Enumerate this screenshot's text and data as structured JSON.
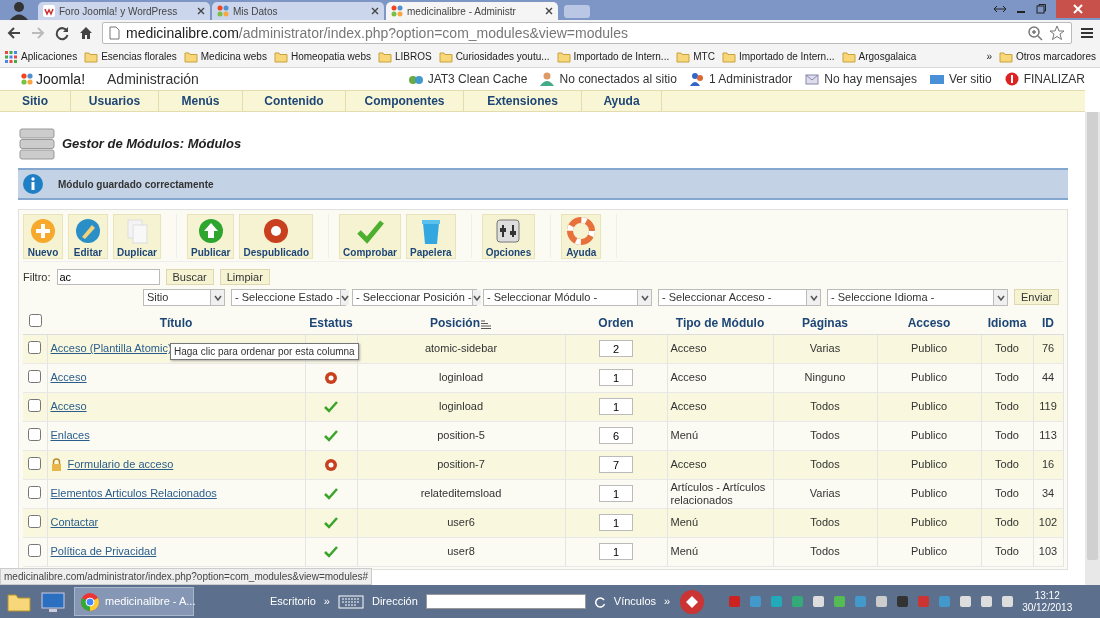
{
  "browser": {
    "tabs": [
      {
        "title": "Foro Joomla! y WordPress",
        "selected": false,
        "kind": "forum"
      },
      {
        "title": "Mis Datos",
        "selected": false,
        "kind": "joomla"
      },
      {
        "title": "medicinalibre - Administr",
        "selected": true,
        "kind": "joomla"
      }
    ],
    "url": {
      "host": "medicinalibre.com",
      "path": "/administrator/index.php?option=com_modules&view=modules"
    },
    "bookmarks": [
      {
        "label": "Aplicaciones",
        "kind": "apps"
      },
      {
        "label": "Esencias florales",
        "kind": "folder"
      },
      {
        "label": "Medicina webs",
        "kind": "folder"
      },
      {
        "label": "Homeopatia webs",
        "kind": "folder"
      },
      {
        "label": "LIBROS",
        "kind": "folder"
      },
      {
        "label": "Curiosidades youtu...",
        "kind": "folder"
      },
      {
        "label": "Importado de Intern...",
        "kind": "folder"
      },
      {
        "label": "MTC",
        "kind": "folder"
      },
      {
        "label": "Importado de Intern...",
        "kind": "folder"
      },
      {
        "label": "Argosgalaica",
        "kind": "folder"
      }
    ],
    "bookmarks_more": "»",
    "other_bookmarks": "Otros marcadores"
  },
  "header": {
    "logo": "Joomla!",
    "title": "Administración",
    "links": [
      {
        "label": "JAT3 Clean Cache",
        "kind": "cache"
      },
      {
        "label": "No conectados al sitio",
        "kind": "users"
      },
      {
        "label": "1 Administrador",
        "kind": "admin"
      },
      {
        "label": "No hay mensajes",
        "kind": "mail"
      },
      {
        "label": "Ver sitio",
        "kind": "site"
      },
      {
        "label": "FINALIZAR",
        "kind": "logout"
      }
    ]
  },
  "menu": [
    "Sitio",
    "Usuarios",
    "Menús",
    "Contenido",
    "Componentes",
    "Extensiones",
    "Ayuda"
  ],
  "page_title": "Gestor de Módulos: Módulos",
  "message": "Módulo guardado correctamente",
  "toolbar": [
    {
      "buttons": [
        {
          "label": "Nuevo",
          "kind": "new"
        },
        {
          "label": "Editar",
          "kind": "edit"
        },
        {
          "label": "Duplicar",
          "kind": "copy"
        }
      ]
    },
    {
      "buttons": [
        {
          "label": "Publicar",
          "kind": "publish"
        },
        {
          "label": "Despublicado",
          "kind": "unpublish"
        }
      ]
    },
    {
      "buttons": [
        {
          "label": "Comprobar",
          "kind": "check"
        },
        {
          "label": "Papelera",
          "kind": "trash"
        }
      ]
    },
    {
      "buttons": [
        {
          "label": "Opciones",
          "kind": "options"
        }
      ]
    },
    {
      "buttons": [
        {
          "label": "Ayuda",
          "kind": "help"
        }
      ]
    }
  ],
  "filter": {
    "label": "Filtro:",
    "value": "ac",
    "search_button": "Buscar",
    "clear_button": "Limpiar"
  },
  "selects": [
    "Sitio",
    "- Seleccione Estado -",
    "- Seleccionar Posición -",
    "- Seleccionar Módulo -",
    "- Seleccionar Acceso -",
    "- Seleccione Idioma -"
  ],
  "submit_button": "Enviar",
  "table": {
    "select_all_checked": false,
    "columns": [
      "Título",
      "Estatus",
      "Posición",
      "Orden",
      "Tipo de Módulo",
      "Páginas",
      "Acceso",
      "Idioma",
      "ID"
    ],
    "rows": [
      {
        "title": "Acceso (Plantilla Atomic)",
        "checked": false,
        "position": "atomic-sidebar",
        "order": "2",
        "type": "Acceso",
        "pages": "Varias",
        "access": "Publico",
        "language": "Todo",
        "id": "76"
      },
      {
        "title": "Acceso",
        "checked": false,
        "published": false,
        "position": "loginload",
        "order": "1",
        "type": "Acceso",
        "pages": "Ninguno",
        "access": "Publico",
        "language": "Todo",
        "id": "44"
      },
      {
        "title": "Acceso",
        "checked": false,
        "published": true,
        "position": "loginload",
        "order": "1",
        "type": "Acceso",
        "pages": "Todos",
        "access": "Publico",
        "language": "Todo",
        "id": "119"
      },
      {
        "title": "Enlaces",
        "checked": false,
        "published": true,
        "position": "position-5",
        "order": "6",
        "type": "Menú",
        "pages": "Todos",
        "access": "Publico",
        "language": "Todo",
        "id": "113"
      },
      {
        "title": "Formulario de acceso",
        "checked": false,
        "locked": true,
        "published": false,
        "position": "position-7",
        "order": "7",
        "type": "Acceso",
        "pages": "Todos",
        "access": "Publico",
        "language": "Todo",
        "id": "16"
      },
      {
        "title": "Elementos Articulos Relacionados",
        "checked": false,
        "published": true,
        "position": "relateditemsload",
        "order": "1",
        "type": "Artículos - Artículos relacionados",
        "pages": "Varias",
        "access": "Publico",
        "language": "Todo",
        "id": "34"
      },
      {
        "title": "Contactar",
        "checked": false,
        "published": true,
        "position": "user6",
        "order": "1",
        "type": "Menú",
        "pages": "Todos",
        "access": "Publico",
        "language": "Todo",
        "id": "102"
      },
      {
        "title": "Política de Privacidad",
        "checked": false,
        "published": true,
        "position": "user8",
        "order": "1",
        "type": "Menú",
        "pages": "Todos",
        "access": "Publico",
        "language": "Todo",
        "id": "103"
      }
    ]
  },
  "tooltip": "Haga clic para ordenar por esta columna",
  "status_url": "medicinalibre.com/administrator/index.php?option=com_modules&view=modules#",
  "taskbar": {
    "task": "medicinalibre - A...",
    "desktop": "Escritorio",
    "address_label": "Dirección",
    "links_label": "Vínculos",
    "more": "»",
    "time": "13:12",
    "date": "30/12/2013"
  }
}
